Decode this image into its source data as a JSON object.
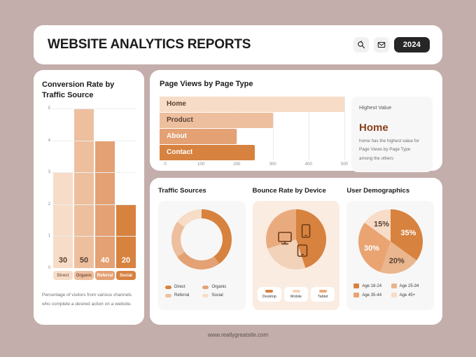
{
  "header": {
    "title": "WEBSITE ANALYTICS REPORTS",
    "search_icon": "search-icon",
    "mail_icon": "envelope-icon",
    "year": "2024"
  },
  "conversion_panel": {
    "title": "Conversion Rate by Traffic Source",
    "note": "Percentage of visitors from various channels who complete a desired action on a website.",
    "y_ticks": [
      "5",
      "4",
      "3",
      "2",
      "1",
      "0"
    ]
  },
  "page_views_panel": {
    "title": "Page Views by Page Type",
    "x_ticks": [
      "0",
      "100",
      "200",
      "300",
      "400",
      "500"
    ],
    "highest": {
      "caption": "Highest Value",
      "value": "Home",
      "description": "home has the highest value for Page Views by Page Type among the others"
    }
  },
  "traffic_sources_panel": {
    "title": "Traffic Sources"
  },
  "bounce_rate_panel": {
    "title": "Bounce Rate by Device"
  },
  "demographics_panel": {
    "title": "User Demographics"
  },
  "footer": {
    "url": "www.reallygreatsite.com"
  },
  "colors": {
    "background": "#c3aeab",
    "card": "#ffffff",
    "accent_dark": "#d7823f",
    "accent_mid": "#e4a173",
    "accent_light": "#edbf9e",
    "accent_pale": "#f7dcc7",
    "text_dark": "#1b1b1b",
    "brown": "#8a3f1b"
  },
  "chart_data": [
    {
      "type": "bar",
      "title": "Conversion Rate by Traffic Source",
      "categories": [
        "Direct",
        "Organic",
        "Referral",
        "Social"
      ],
      "values": [
        3,
        5,
        4,
        2
      ],
      "data_labels": [
        "30",
        "50",
        "40",
        "20"
      ],
      "label_colors": [
        "#5a4034",
        "#5a4034",
        "#ffffff",
        "#ffffff"
      ],
      "bar_colors": [
        "#f7dcc7",
        "#edbf9e",
        "#e4a173",
        "#d7823f"
      ],
      "pill_text_colors": [
        "#8a6a55",
        "#7a5740",
        "#ffffff",
        "#ffffff"
      ],
      "xlabel": "",
      "ylabel": "",
      "ylim": [
        0,
        5
      ],
      "yticks": [
        0,
        1,
        2,
        3,
        4,
        5
      ],
      "grid": true
    },
    {
      "type": "bar",
      "orientation": "horizontal",
      "title": "Page Views by Page Type",
      "categories": [
        "Home",
        "Product",
        "About",
        "Contact"
      ],
      "values": [
        500,
        300,
        200,
        250
      ],
      "bar_colors": [
        "#f7dcc7",
        "#edbf9e",
        "#e4a173",
        "#d7823f"
      ],
      "label_colors": [
        "#5a4034",
        "#5a4034",
        "#ffffff",
        "#ffffff"
      ],
      "xlim": [
        0,
        500
      ],
      "xticks": [
        0,
        100,
        200,
        300,
        400,
        500
      ],
      "grid": true
    },
    {
      "type": "pie",
      "variant": "donut",
      "title": "Traffic Sources",
      "categories": [
        "Direct",
        "Organic",
        "Referral",
        "Social"
      ],
      "values": [
        40,
        25,
        20,
        15
      ],
      "colors": [
        "#d7823f",
        "#e4a173",
        "#edbf9e",
        "#f7dcc7"
      ],
      "legend": "bottom"
    },
    {
      "type": "pie",
      "title": "Bounce Rate by Device",
      "categories": [
        "Desktop",
        "Mobile",
        "Tablet"
      ],
      "values": [
        45,
        25,
        30
      ],
      "colors": [
        "#d7823f",
        "#f2d3ba",
        "#e9ab7e"
      ],
      "icons": [
        "monitor-icon",
        "phone-icon",
        "tablet-icon"
      ],
      "legend": "bottom"
    },
    {
      "type": "pie",
      "title": "User Demographics",
      "categories": [
        "Age 18-24",
        "Age 25-34",
        "Age 35-44",
        "Age 45+"
      ],
      "values": [
        35,
        20,
        30,
        15
      ],
      "data_labels": [
        "35%",
        "20%",
        "30%",
        "15%"
      ],
      "colors": [
        "#d7823f",
        "#e9b68e",
        "#e9a472",
        "#f7dcc7"
      ],
      "label_colors": [
        "#ffffff",
        "#5a4034",
        "#ffffff",
        "#5a4034"
      ],
      "legend": "bottom"
    }
  ]
}
